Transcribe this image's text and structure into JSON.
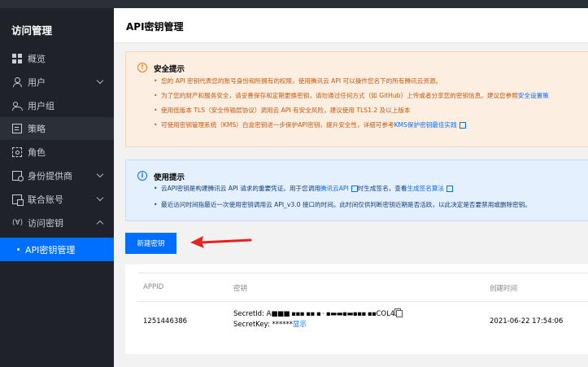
{
  "sidebar": {
    "title": "访问管理",
    "items": [
      {
        "label": "概览",
        "icon": "overview-icon"
      },
      {
        "label": "用户",
        "icon": "user-icon"
      },
      {
        "label": "用户组",
        "icon": "user-group-icon"
      },
      {
        "label": "策略",
        "icon": "policy-icon"
      },
      {
        "label": "角色",
        "icon": "role-icon"
      },
      {
        "label": "身份提供商",
        "icon": "identity-provider-icon"
      },
      {
        "label": "联合账号",
        "icon": "federated-account-icon"
      },
      {
        "label": "访问密钥",
        "icon_text": "(∀)"
      },
      {
        "label": "API密钥管理"
      }
    ]
  },
  "header": {
    "title": "API密钥管理"
  },
  "security_tip": {
    "title": "安全提示",
    "lines": [
      "您的 API 密钥代表您的账号身份和所拥有的权限，使用腾讯云 API 可以操作您名下的所有腾讯云资源。",
      "为了您的财产和服务安全，请妥善保存和定期更换密钥，请勿通过任何方式（如 GitHub）上传或者分享您的密钥信息。建议您参照",
      "使用低版本 TLS（安全传输层协议）调用云 API 有安全风险，建议使用 TLS1.2 及以上版本",
      "可使用密钥管理系统（KMS）白盒密钥进一步保护API密钥，提升安全性，详细可参考"
    ],
    "link_security_settings": "安全设置策",
    "link_kms": "KMS保护密钥最佳实践"
  },
  "usage_tip": {
    "title": "使用提示",
    "line1_a": "云API密钥是构建腾讯云 API 请求的重要凭证。用于您调用",
    "line1_link1": "腾讯云API",
    "line1_b": "时生成签名，查看",
    "line1_link2": "生成签名算法",
    "line2": "最近访问时间指最近一次使用密钥调用云 API_v3.0 接口的时间。此时间仅供判断密钥近期是否活跃，以此决定是否要禁用或删除密钥。"
  },
  "create_button": "新建密钥",
  "table": {
    "headers": [
      "APPID",
      "密钥",
      "创建时间"
    ],
    "rows": [
      {
        "appid": "1251446386",
        "secret_id_label": "SecretId: A",
        "secret_id_masked": "■■■ ▪▪▪ ▪▪  ▪  ·  ▪▬▬▪▬▪▪▪ ▪▪",
        "secret_id_suffix": "COL4",
        "secret_key_label": "SecretKey: ******",
        "secret_key_action": "显示",
        "created": "2021-06-22 17:54:06"
      }
    ]
  },
  "colors": {
    "primary": "#006eff",
    "sidebar_bg": "#1f2329",
    "warn_bg": "#fdeee2",
    "info_bg": "#e5f0ff",
    "arrow": "#e8211d"
  }
}
